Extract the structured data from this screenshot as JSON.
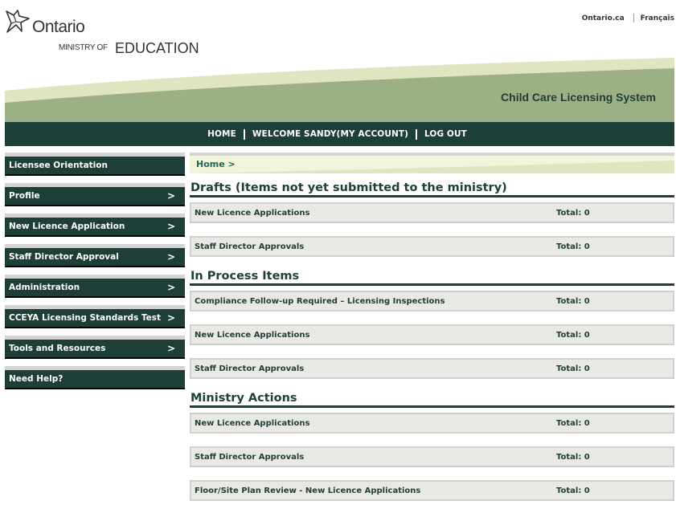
{
  "branding": {
    "wordmark": "Ontario",
    "ministry_of": "MINISTRY OF",
    "ministry_name": "EDUCATION",
    "system_title": "Child Care Licensing System",
    "colors": {
      "dark_green": "#1e3f37",
      "mid_green": "#9daf84",
      "light_green": "#dfe5c0",
      "row_bg": "#e8e8e4",
      "breadcrumb_text": "#1f6455"
    }
  },
  "top_links": [
    {
      "label": "Ontario.ca"
    },
    {
      "label": "Français"
    }
  ],
  "topnav": {
    "home": "HOME",
    "account": "WELCOME SANDY(MY ACCOUNT)",
    "logout": "LOG OUT"
  },
  "sidebar": {
    "items": [
      {
        "label": "Licensee Orientation",
        "chevron": ""
      },
      {
        "label": "Profile",
        "chevron": ">"
      },
      {
        "label": "New Licence Application",
        "chevron": ">"
      },
      {
        "label": "Staff Director Approval",
        "chevron": ">"
      },
      {
        "label": "Administration",
        "chevron": ">"
      },
      {
        "label": "CCEYA Licensing Standards Test",
        "chevron": ">"
      },
      {
        "label": "Tools and Resources",
        "chevron": ">"
      },
      {
        "label": "Need Help?",
        "chevron": ""
      }
    ]
  },
  "breadcrumb": "Home >",
  "sections": [
    {
      "title": "Drafts (Items not yet submitted to the ministry)",
      "rows": [
        {
          "label": "New Licence Applications",
          "total": "Total: 0"
        },
        {
          "label": "Staff Director Approvals",
          "total": "Total: 0"
        }
      ]
    },
    {
      "title": "In Process Items",
      "rows": [
        {
          "label": "Compliance Follow-up Required – Licensing Inspections",
          "total": "Total: 0"
        },
        {
          "label": "New Licence Applications",
          "total": "Total: 0"
        },
        {
          "label": "Staff Director Approvals",
          "total": "Total: 0"
        }
      ]
    },
    {
      "title": "Ministry Actions",
      "rows": [
        {
          "label": "New Licence Applications",
          "total": "Total: 0"
        },
        {
          "label": "Staff Director Approvals",
          "total": "Total: 0"
        },
        {
          "label": "Floor/Site Plan Review - New Licence Applications",
          "total": "Total: 0"
        }
      ]
    }
  ]
}
